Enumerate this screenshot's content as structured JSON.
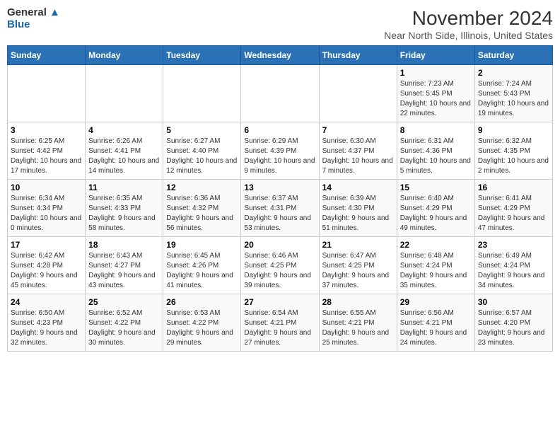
{
  "logo": {
    "general": "General",
    "blue": "Blue"
  },
  "title": "November 2024",
  "location": "Near North Side, Illinois, United States",
  "days_header": [
    "Sunday",
    "Monday",
    "Tuesday",
    "Wednesday",
    "Thursday",
    "Friday",
    "Saturday"
  ],
  "weeks": [
    [
      {
        "day": "",
        "info": ""
      },
      {
        "day": "",
        "info": ""
      },
      {
        "day": "",
        "info": ""
      },
      {
        "day": "",
        "info": ""
      },
      {
        "day": "",
        "info": ""
      },
      {
        "day": "1",
        "info": "Sunrise: 7:23 AM\nSunset: 5:45 PM\nDaylight: 10 hours and 22 minutes."
      },
      {
        "day": "2",
        "info": "Sunrise: 7:24 AM\nSunset: 5:43 PM\nDaylight: 10 hours and 19 minutes."
      }
    ],
    [
      {
        "day": "3",
        "info": "Sunrise: 6:25 AM\nSunset: 4:42 PM\nDaylight: 10 hours and 17 minutes."
      },
      {
        "day": "4",
        "info": "Sunrise: 6:26 AM\nSunset: 4:41 PM\nDaylight: 10 hours and 14 minutes."
      },
      {
        "day": "5",
        "info": "Sunrise: 6:27 AM\nSunset: 4:40 PM\nDaylight: 10 hours and 12 minutes."
      },
      {
        "day": "6",
        "info": "Sunrise: 6:29 AM\nSunset: 4:39 PM\nDaylight: 10 hours and 9 minutes."
      },
      {
        "day": "7",
        "info": "Sunrise: 6:30 AM\nSunset: 4:37 PM\nDaylight: 10 hours and 7 minutes."
      },
      {
        "day": "8",
        "info": "Sunrise: 6:31 AM\nSunset: 4:36 PM\nDaylight: 10 hours and 5 minutes."
      },
      {
        "day": "9",
        "info": "Sunrise: 6:32 AM\nSunset: 4:35 PM\nDaylight: 10 hours and 2 minutes."
      }
    ],
    [
      {
        "day": "10",
        "info": "Sunrise: 6:34 AM\nSunset: 4:34 PM\nDaylight: 10 hours and 0 minutes."
      },
      {
        "day": "11",
        "info": "Sunrise: 6:35 AM\nSunset: 4:33 PM\nDaylight: 9 hours and 58 minutes."
      },
      {
        "day": "12",
        "info": "Sunrise: 6:36 AM\nSunset: 4:32 PM\nDaylight: 9 hours and 56 minutes."
      },
      {
        "day": "13",
        "info": "Sunrise: 6:37 AM\nSunset: 4:31 PM\nDaylight: 9 hours and 53 minutes."
      },
      {
        "day": "14",
        "info": "Sunrise: 6:39 AM\nSunset: 4:30 PM\nDaylight: 9 hours and 51 minutes."
      },
      {
        "day": "15",
        "info": "Sunrise: 6:40 AM\nSunset: 4:29 PM\nDaylight: 9 hours and 49 minutes."
      },
      {
        "day": "16",
        "info": "Sunrise: 6:41 AM\nSunset: 4:29 PM\nDaylight: 9 hours and 47 minutes."
      }
    ],
    [
      {
        "day": "17",
        "info": "Sunrise: 6:42 AM\nSunset: 4:28 PM\nDaylight: 9 hours and 45 minutes."
      },
      {
        "day": "18",
        "info": "Sunrise: 6:43 AM\nSunset: 4:27 PM\nDaylight: 9 hours and 43 minutes."
      },
      {
        "day": "19",
        "info": "Sunrise: 6:45 AM\nSunset: 4:26 PM\nDaylight: 9 hours and 41 minutes."
      },
      {
        "day": "20",
        "info": "Sunrise: 6:46 AM\nSunset: 4:25 PM\nDaylight: 9 hours and 39 minutes."
      },
      {
        "day": "21",
        "info": "Sunrise: 6:47 AM\nSunset: 4:25 PM\nDaylight: 9 hours and 37 minutes."
      },
      {
        "day": "22",
        "info": "Sunrise: 6:48 AM\nSunset: 4:24 PM\nDaylight: 9 hours and 35 minutes."
      },
      {
        "day": "23",
        "info": "Sunrise: 6:49 AM\nSunset: 4:24 PM\nDaylight: 9 hours and 34 minutes."
      }
    ],
    [
      {
        "day": "24",
        "info": "Sunrise: 6:50 AM\nSunset: 4:23 PM\nDaylight: 9 hours and 32 minutes."
      },
      {
        "day": "25",
        "info": "Sunrise: 6:52 AM\nSunset: 4:22 PM\nDaylight: 9 hours and 30 minutes."
      },
      {
        "day": "26",
        "info": "Sunrise: 6:53 AM\nSunset: 4:22 PM\nDaylight: 9 hours and 29 minutes."
      },
      {
        "day": "27",
        "info": "Sunrise: 6:54 AM\nSunset: 4:21 PM\nDaylight: 9 hours and 27 minutes."
      },
      {
        "day": "28",
        "info": "Sunrise: 6:55 AM\nSunset: 4:21 PM\nDaylight: 9 hours and 25 minutes."
      },
      {
        "day": "29",
        "info": "Sunrise: 6:56 AM\nSunset: 4:21 PM\nDaylight: 9 hours and 24 minutes."
      },
      {
        "day": "30",
        "info": "Sunrise: 6:57 AM\nSunset: 4:20 PM\nDaylight: 9 hours and 23 minutes."
      }
    ]
  ]
}
